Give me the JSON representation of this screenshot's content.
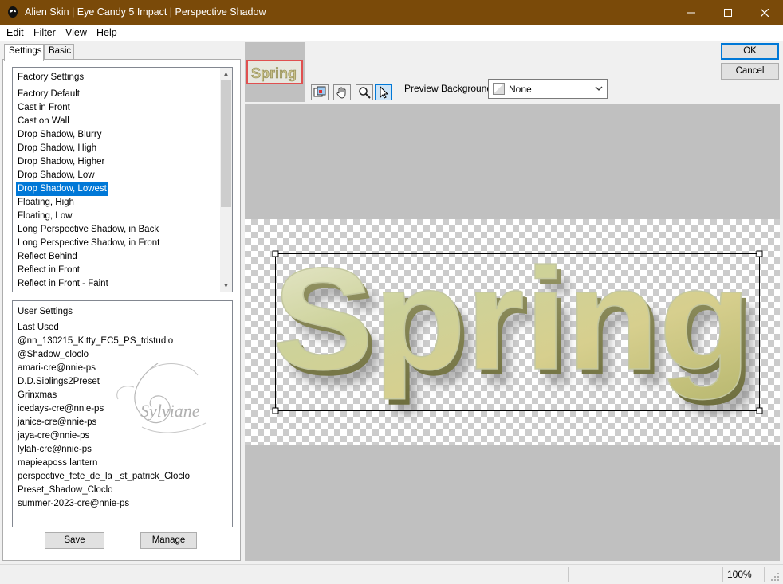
{
  "window": {
    "title": "Alien Skin | Eye Candy 5 Impact | Perspective Shadow"
  },
  "menu": [
    {
      "label": "Edit"
    },
    {
      "label": "Filter"
    },
    {
      "label": "View"
    },
    {
      "label": "Help"
    }
  ],
  "tabs": [
    {
      "label": "Settings"
    },
    {
      "label": "Basic"
    }
  ],
  "factory_settings": {
    "header": "Factory Settings",
    "items": [
      "Factory Default",
      "Cast in Front",
      "Cast on Wall",
      "Drop Shadow, Blurry",
      "Drop Shadow, High",
      "Drop Shadow, Higher",
      "Drop Shadow, Low",
      "Drop Shadow, Lowest",
      "Floating, High",
      "Floating, Low",
      "Long Perspective Shadow, in Back",
      "Long Perspective Shadow, in Front",
      "Reflect Behind",
      "Reflect in Front",
      "Reflect in Front - Faint"
    ],
    "selected": "Drop Shadow, Lowest"
  },
  "user_settings": {
    "header": "User Settings",
    "items": [
      "Last Used",
      "@nn_130215_Kitty_EC5_PS_tdstudio",
      "@Shadow_cloclo",
      "amari-cre@nnie-ps",
      "D.D.Siblings2Preset",
      "Grinxmas",
      "icedays-cre@nnie-ps",
      "janice-cre@nnie-ps",
      "jaya-cre@nnie-ps",
      "lylah-cre@nnie-ps",
      "mapieaposs lantern",
      "perspective_fete_de_la _st_patrick_Cloclo",
      "Preset_Shadow_Cloclo",
      "summer-2023-cre@nnie-ps"
    ],
    "watermark": "Sylviane"
  },
  "buttons": {
    "save": "Save",
    "manage": "Manage",
    "ok": "OK",
    "cancel": "Cancel"
  },
  "preview": {
    "background_label": "Preview Background:",
    "background_value": "None",
    "image_text": "Spring",
    "thumbnail_text": "Spring"
  },
  "tools": [
    {
      "icon": "navigate-icon"
    },
    {
      "icon": "hand-icon"
    },
    {
      "icon": "zoom-icon"
    },
    {
      "icon": "pointer-icon"
    }
  ],
  "status": {
    "zoom": "100%"
  },
  "colors": {
    "titlebar": "#7a4a09",
    "selection": "#0078d7",
    "preview_bg": "#c0c0c0"
  }
}
